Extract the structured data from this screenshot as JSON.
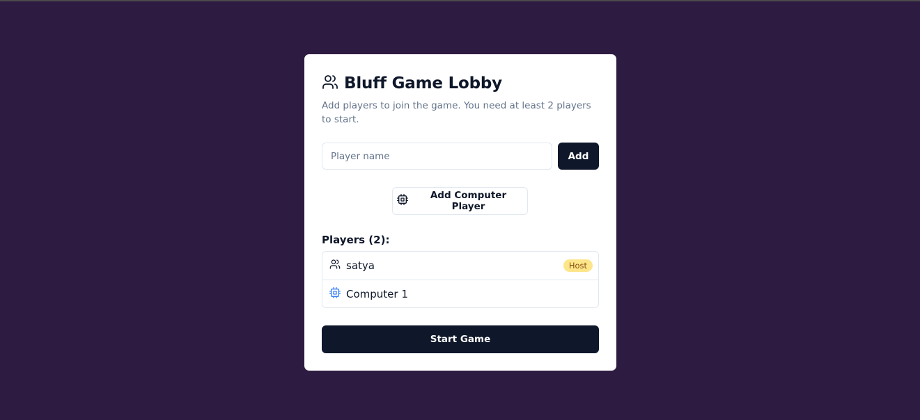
{
  "lobby": {
    "title": "Bluff Game Lobby",
    "title_icon": "users-icon",
    "subtitle": "Add players to join the game. You need at least 2 players to start."
  },
  "add_player": {
    "input_value": "",
    "placeholder": "Player name",
    "add_label": "Add"
  },
  "computer_button": {
    "label": "Add Computer Player",
    "icon": "cpu-icon"
  },
  "players": {
    "heading": "Players (2):",
    "items": [
      {
        "name": "satya",
        "icon": "users-icon",
        "badge": "Host"
      },
      {
        "name": "Computer 1",
        "icon": "cpu-icon",
        "badge": ""
      }
    ]
  },
  "start_button": {
    "label": "Start Game"
  },
  "colors": {
    "background": "#2e1b41",
    "card": "#ffffff",
    "primary": "#0f172a",
    "muted_text": "#64748b",
    "host_badge": "#fde68a",
    "computer_icon": "#3b82f6"
  }
}
